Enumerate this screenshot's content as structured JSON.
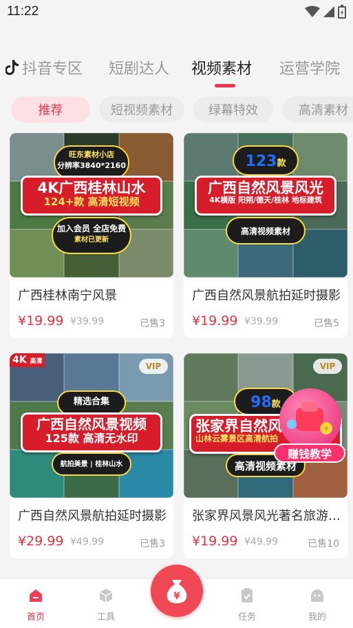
{
  "status_bar": {
    "time": "11:22"
  },
  "top_tabs": [
    {
      "label": "抖音专区",
      "active": false
    },
    {
      "label": "短剧达人",
      "active": false
    },
    {
      "label": "视频素材",
      "active": true
    },
    {
      "label": "运营学院",
      "active": false
    }
  ],
  "chips": [
    {
      "label": "推荐",
      "active": true
    },
    {
      "label": "短视频素材",
      "active": false
    },
    {
      "label": "绿幕特效",
      "active": false
    },
    {
      "label": "高清素材",
      "active": false
    }
  ],
  "products": [
    {
      "title": "广西桂林南宁风景",
      "price": "¥19.99",
      "original_price": "¥39.99",
      "sold": "已售3",
      "thumb": {
        "top_line1": "旺东素材小店",
        "top_line2": "分辨率3840*2160",
        "banner_line1": "4K广西桂林山水",
        "banner_line2": "124+款 高清短视频",
        "bottom_line1": "加入会员 全店免费",
        "bottom_line2": "素材已更新"
      }
    },
    {
      "title": "广西自然风景航拍延时摄影",
      "price": "¥19.99",
      "original_price": "¥39.99",
      "sold": "已售5",
      "thumb": {
        "count": "123",
        "count_unit": "款",
        "banner_line1": "广西自然风景风光",
        "banner_line2": "4K横版 阳朔/德天/桂林 地标建筑",
        "bottom_line1": "高清视频素材"
      }
    },
    {
      "title": "广西自然风景航拍延时摄影",
      "price": "¥29.99",
      "original_price": "¥49.99",
      "sold": "已售3",
      "thumb": {
        "corner": "4K",
        "corner_sub": "高清",
        "vip": "VIP",
        "top_line1": "精选合集",
        "banner_line1": "广西自然风景视频",
        "banner_line2": "125款 高清无水印",
        "bottom_line1": "航拍美景 | 桂林山水"
      }
    },
    {
      "title": "张家界风景风光著名旅游景点",
      "price": "¥19.99",
      "original_price": "¥49.99",
      "sold": "已售10",
      "thumb": {
        "vip": "VIP",
        "count": "98",
        "count_unit": "款",
        "banner_line1": "张家界自然风",
        "banner_line2": "山林云雾景区高清航拍",
        "bottom_line1": "高清视频素材"
      }
    }
  ],
  "earn_badge": {
    "label": "赚钱教学"
  },
  "bottom_nav": [
    {
      "label": "首页",
      "icon": "home-icon",
      "active": true
    },
    {
      "label": "工具",
      "icon": "cube-icon",
      "active": false
    },
    {
      "label": "",
      "icon": "money-bag-icon",
      "active": false
    },
    {
      "label": "任务",
      "icon": "clipboard-check-icon",
      "active": false
    },
    {
      "label": "我的",
      "icon": "profile-icon",
      "active": false
    }
  ],
  "colors": {
    "accent": "#e8303f",
    "chip_active_bg": "#fde0e3",
    "center_button": "#f14856"
  }
}
